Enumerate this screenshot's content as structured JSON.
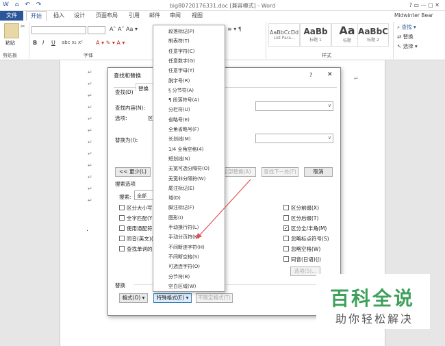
{
  "titlebar": {
    "title": "big80720176331.doc [兼容模式] - Word",
    "user": "Midwinter Bear"
  },
  "tabs": [
    "文件",
    "开始",
    "插入",
    "设计",
    "页面布局",
    "引用",
    "邮件",
    "审阅",
    "视图"
  ],
  "ribbon": {
    "paste": "粘贴",
    "clipboard": "剪贴板",
    "font_group": "字体",
    "styles_group": "样式",
    "styles": [
      {
        "preview": "AaBbCcDd",
        "name": "List Para..."
      },
      {
        "preview": "AaBb",
        "name": "标题 1"
      },
      {
        "preview": "Aa",
        "name": "标题"
      },
      {
        "preview": "AaBbC",
        "name": "标题 2"
      }
    ],
    "find": "查找",
    "replace": "替换",
    "select": "选择",
    "bold": "B",
    "italic": "I",
    "underline": "U"
  },
  "dialog": {
    "title": "查找和替换",
    "help": "?",
    "close": "✕",
    "tab_find": "查找(D)",
    "tab_replace": "替换",
    "find_label": "查找内容(N):",
    "options_label": "选项:",
    "options_value": "区",
    "replace_label": "替换为(I):",
    "less_button": "<< 更少(L)",
    "replace_all": "全部替换(A)",
    "find_next": "查找下一处(F)",
    "cancel": "取消",
    "search_options": "搜索选项",
    "search_label": "搜索:",
    "search_value": "全部",
    "left_checks": [
      {
        "label": "区分大小写",
        "checked": false
      },
      {
        "label": "全字匹配(Y)",
        "checked": false
      },
      {
        "label": "使用通配符",
        "checked": false
      },
      {
        "label": "同音(英文)(",
        "checked": false
      },
      {
        "label": "查找单词的所",
        "checked": false
      }
    ],
    "right_checks": [
      {
        "label": "区分前缀(X)",
        "checked": false
      },
      {
        "label": "区分后缀(T)",
        "checked": false
      },
      {
        "label": "区分全/半角(M)",
        "checked": true
      },
      {
        "label": "忽略标点符号(S)",
        "checked": false
      },
      {
        "label": "忽略空格(W)",
        "checked": false
      },
      {
        "label": "同音(日语)(J)",
        "checked": false
      }
    ],
    "options_button": "选项(S)...",
    "replace_section": "替换",
    "format_button": "格式(O) ▾",
    "special_button": "特殊格式(E) ▾",
    "no_format_button": "不限定格式(T)"
  },
  "special_menu": [
    "段落标记(P)",
    "制表符(T)",
    "任意字符(C)",
    "任意数字(G)",
    "任意字母(Y)",
    "脱字号(R)",
    "§ 分节符(A)",
    "¶ 段落符号(A)",
    "分栏符(U)",
    "省略号(E)",
    "全角省略号(F)",
    "长划线(M)",
    "1/4 全角空格(4)",
    "短划线(N)",
    "无宽可选分隔符(O)",
    "无宽非分隔符(W)",
    "尾注标记(E)",
    "域(D)",
    "脚注标记(F)",
    "图形(I)",
    "手动换行符(L)",
    "手动分页符(K)",
    "不间断连字符(H)",
    "不间断空格(S)",
    "可选连字符(O)",
    "分节符(B)",
    "空白区域(W)"
  ],
  "watermark": {
    "line1": "百科全说",
    "line2": "助你轻松解决"
  },
  "colors": {
    "accent": "#2b579a",
    "watermark_green": "#3ea05a",
    "arrow": "#e05050"
  }
}
